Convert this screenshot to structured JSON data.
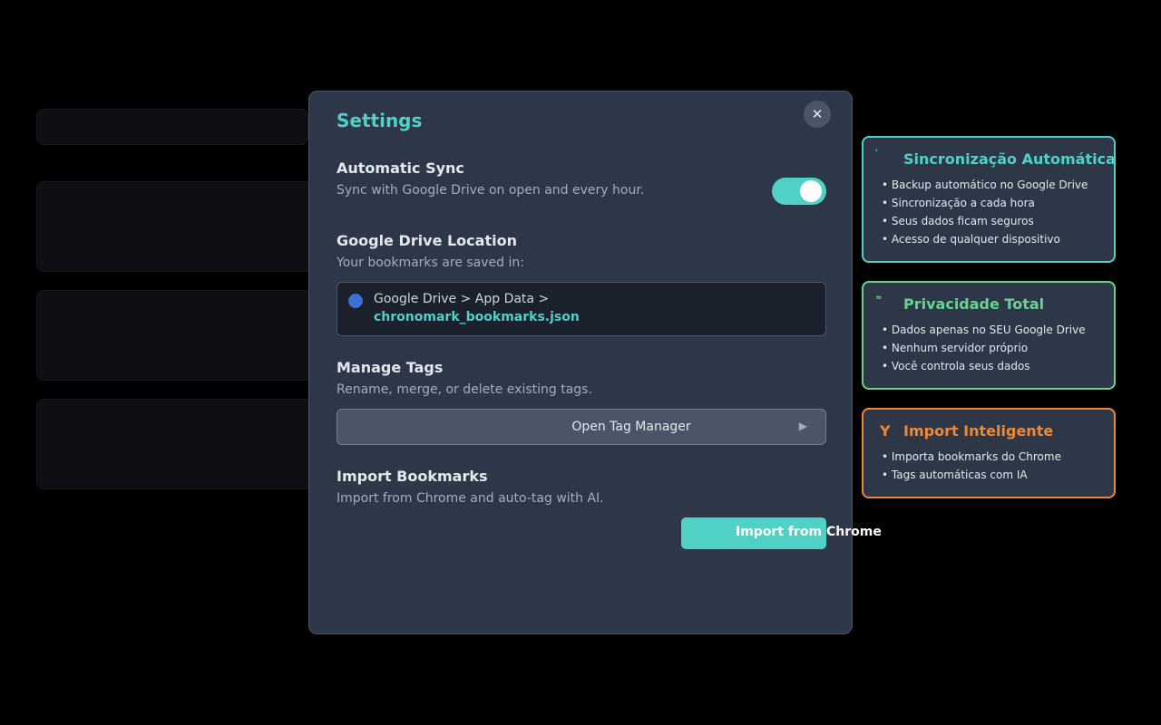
{
  "modal": {
    "title": "Settings",
    "close_glyph": "✕",
    "sync": {
      "title": "Automatic Sync",
      "desc": "Sync with Google Drive on open and every hour.",
      "enabled": true
    },
    "drive": {
      "title": "Google Drive Location",
      "desc": "Your bookmarks are saved in:",
      "path": "Google Drive > App Data >",
      "file": "chronomark_bookmarks.json"
    },
    "tags": {
      "title": "Manage Tags",
      "desc": "Rename, merge, or delete existing tags.",
      "button": "Open Tag Manager",
      "arrow": "▶"
    },
    "import": {
      "title": "Import Bookmarks",
      "desc": "Import from Chrome and auto-tag with AI.",
      "button": "Import from Chrome"
    }
  },
  "cards": [
    {
      "icon": "'",
      "title": "Sincronização Automática",
      "color": "#4fd1c5",
      "items": [
        "• Backup automático no Google Drive",
        "• Sincronização a cada hora",
        "• Seus dados ficam seguros",
        "• Acesso de qualquer dispositivo"
      ]
    },
    {
      "icon": "≈",
      "title": "Privacidade Total",
      "color": "#68d391",
      "items": [
        "• Dados apenas no SEU Google Drive",
        "• Nenhum servidor próprio",
        "• Você controla seus dados"
      ]
    },
    {
      "icon": "Y",
      "title": "Import Inteligente",
      "color": "#ed8936",
      "items": [
        "• Importa bookmarks do Chrome",
        "• Tags automáticas com IA"
      ]
    }
  ]
}
